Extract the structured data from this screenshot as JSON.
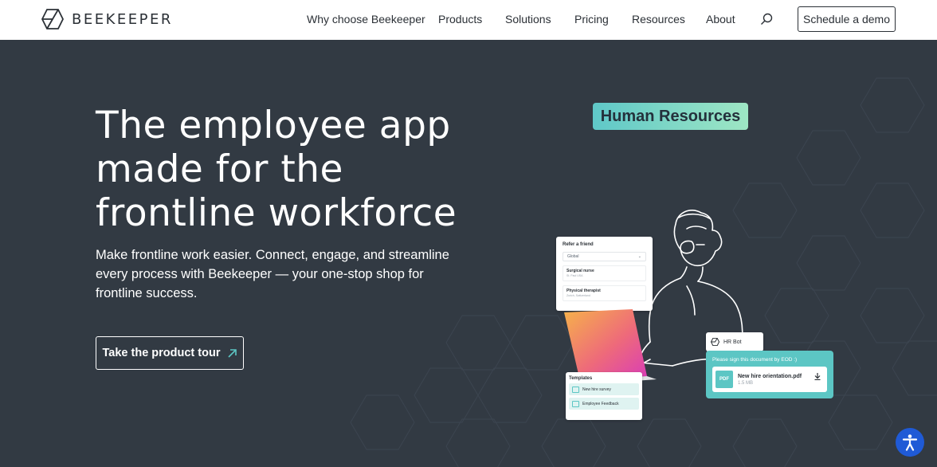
{
  "brand": {
    "name": "BEEKEEPER"
  },
  "nav": {
    "items": [
      "Why choose Beekeeper",
      "Products",
      "Solutions",
      "Pricing",
      "Resources",
      "About"
    ],
    "cta": "Schedule a demo"
  },
  "hero": {
    "title_lines": [
      "The employee app",
      "made for the",
      "frontline workforce"
    ],
    "subtitle": "Make frontline work easier. Connect, engage, and streamline every process with Beekeeper — your one-stop shop for frontline success.",
    "cta": "Take the product tour"
  },
  "illustration": {
    "badge": "Human Resources",
    "refer_card": {
      "title": "Refer a friend",
      "select": "Global",
      "rows": [
        {
          "title": "Surgical nurse",
          "sub": "St. Paul USA"
        },
        {
          "title": "Physical therapist",
          "sub": "Zurich, Switzerland"
        }
      ]
    },
    "hrbot": {
      "name": "HR Bot"
    },
    "sign": {
      "message": "Please sign this document by EOD :)",
      "file_type": "PDF",
      "file_name": "New hire orientation.pdf",
      "file_size": "1.5 MB"
    },
    "templates": {
      "title": "Templates",
      "items": [
        "New hire survey",
        "Employee Feedback"
      ]
    }
  },
  "colors": {
    "background": "#323a43",
    "accent_teal": "#5cc6c4",
    "accessibility": "#1f5ad6"
  },
  "icons": [
    "hexagon-logo-icon",
    "search-icon",
    "arrow-up-right-icon",
    "download-icon",
    "accessibility-icon"
  ]
}
